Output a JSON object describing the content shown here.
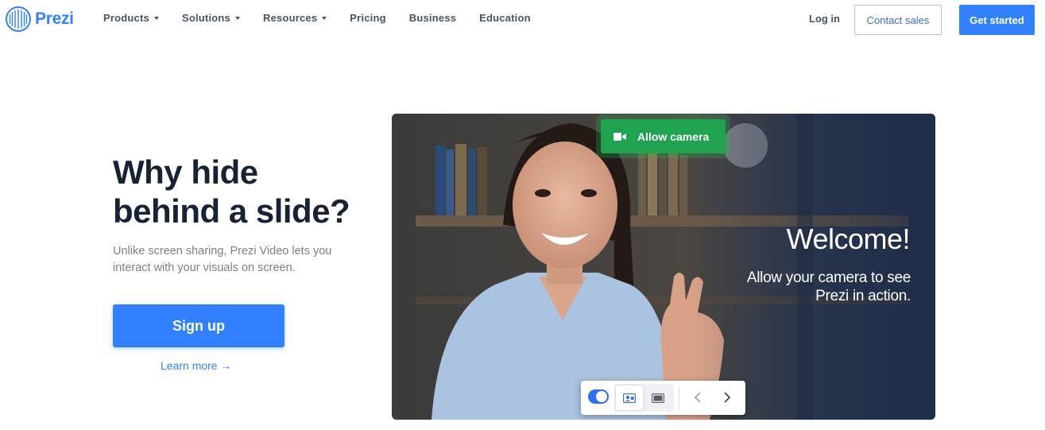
{
  "brand": {
    "name": "Prezi",
    "color": "#3181ff",
    "logo_icon": "prezi-logo-icon"
  },
  "nav": {
    "items": [
      {
        "label": "Products",
        "dropdown": true
      },
      {
        "label": "Solutions",
        "dropdown": true
      },
      {
        "label": "Resources",
        "dropdown": true
      },
      {
        "label": "Pricing",
        "dropdown": false
      },
      {
        "label": "Business",
        "dropdown": false
      },
      {
        "label": "Education",
        "dropdown": false
      }
    ],
    "login": "Log in",
    "contact_sales": "Contact sales",
    "get_started": "Get started"
  },
  "hero": {
    "title_line1": "Why hide",
    "title_line2": "behind a slide?",
    "subtitle": "Unlike screen sharing, Prezi Video lets you interact with your visuals on screen.",
    "signup": "Sign up",
    "learn_more": "Learn more →"
  },
  "video": {
    "allow_camera": "Allow camera",
    "welcome": "Welcome!",
    "welcome_sub_line1": "Allow your camera to see",
    "welcome_sub_line2": "Prezi in action.",
    "camera_on": true,
    "accent_green": "#1fa351",
    "toggle_color": "#2d6ff2"
  },
  "icons": {
    "camera": "video-camera-icon",
    "mode_person": "person-layout-icon",
    "mode_screen": "screen-layout-icon",
    "prev": "chevron-left-icon",
    "next": "chevron-right-icon"
  }
}
